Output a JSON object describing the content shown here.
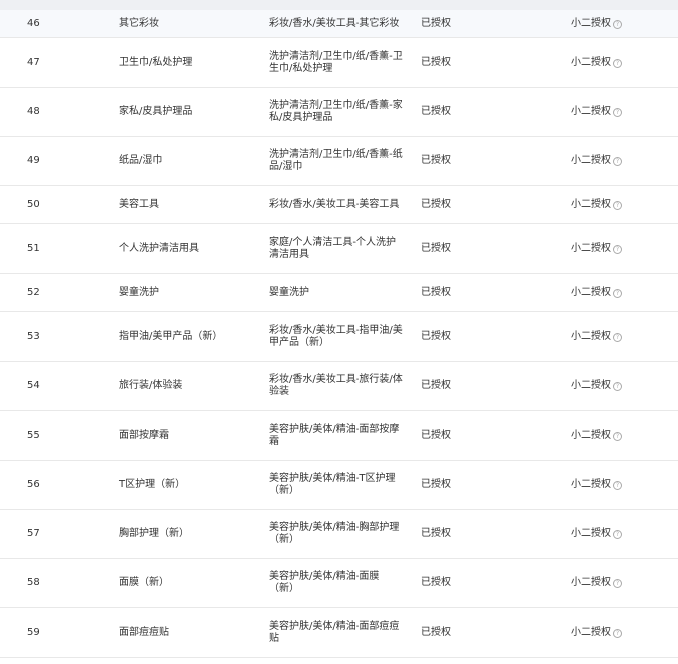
{
  "table": {
    "rows": [
      {
        "idx": "46",
        "name": "其它彩妆",
        "path": "彩妆/香水/美妆工具-其它彩妆",
        "status": "已授权",
        "auth": "小二授权"
      },
      {
        "idx": "47",
        "name": "卫生巾/私处护理",
        "path": "洗护清洁剂/卫生巾/纸/香薰-卫生巾/私处护理",
        "status": "已授权",
        "auth": "小二授权"
      },
      {
        "idx": "48",
        "name": "家私/皮具护理品",
        "path": "洗护清洁剂/卫生巾/纸/香薰-家私/皮具护理品",
        "status": "已授权",
        "auth": "小二授权"
      },
      {
        "idx": "49",
        "name": "纸品/湿巾",
        "path": "洗护清洁剂/卫生巾/纸/香薰-纸品/湿巾",
        "status": "已授权",
        "auth": "小二授权"
      },
      {
        "idx": "50",
        "name": "美容工具",
        "path": "彩妆/香水/美妆工具-美容工具",
        "status": "已授权",
        "auth": "小二授权"
      },
      {
        "idx": "51",
        "name": "个人洗护清洁用具",
        "path": "家庭/个人清洁工具-个人洗护清洁用具",
        "status": "已授权",
        "auth": "小二授权"
      },
      {
        "idx": "52",
        "name": "婴童洗护",
        "path": "婴童洗护",
        "status": "已授权",
        "auth": "小二授权"
      },
      {
        "idx": "53",
        "name": "指甲油/美甲产品（新）",
        "path": "彩妆/香水/美妆工具-指甲油/美甲产品（新）",
        "status": "已授权",
        "auth": "小二授权"
      },
      {
        "idx": "54",
        "name": "旅行装/体验装",
        "path": "彩妆/香水/美妆工具-旅行装/体验装",
        "status": "已授权",
        "auth": "小二授权"
      },
      {
        "idx": "55",
        "name": "面部按摩霜",
        "path": "美容护肤/美体/精油-面部按摩霜",
        "status": "已授权",
        "auth": "小二授权"
      },
      {
        "idx": "56",
        "name": "T区护理（新）",
        "path": "美容护肤/美体/精油-T区护理（新）",
        "status": "已授权",
        "auth": "小二授权"
      },
      {
        "idx": "57",
        "name": "胸部护理（新）",
        "path": "美容护肤/美体/精油-胸部护理（新）",
        "status": "已授权",
        "auth": "小二授权"
      },
      {
        "idx": "58",
        "name": "面膜（新）",
        "path": "美容护肤/美体/精油-面膜（新）",
        "status": "已授权",
        "auth": "小二授权"
      },
      {
        "idx": "59",
        "name": "面部痘痘贴",
        "path": "美容护肤/美体/精油-面部痘痘贴",
        "status": "已授权",
        "auth": "小二授权"
      }
    ]
  }
}
